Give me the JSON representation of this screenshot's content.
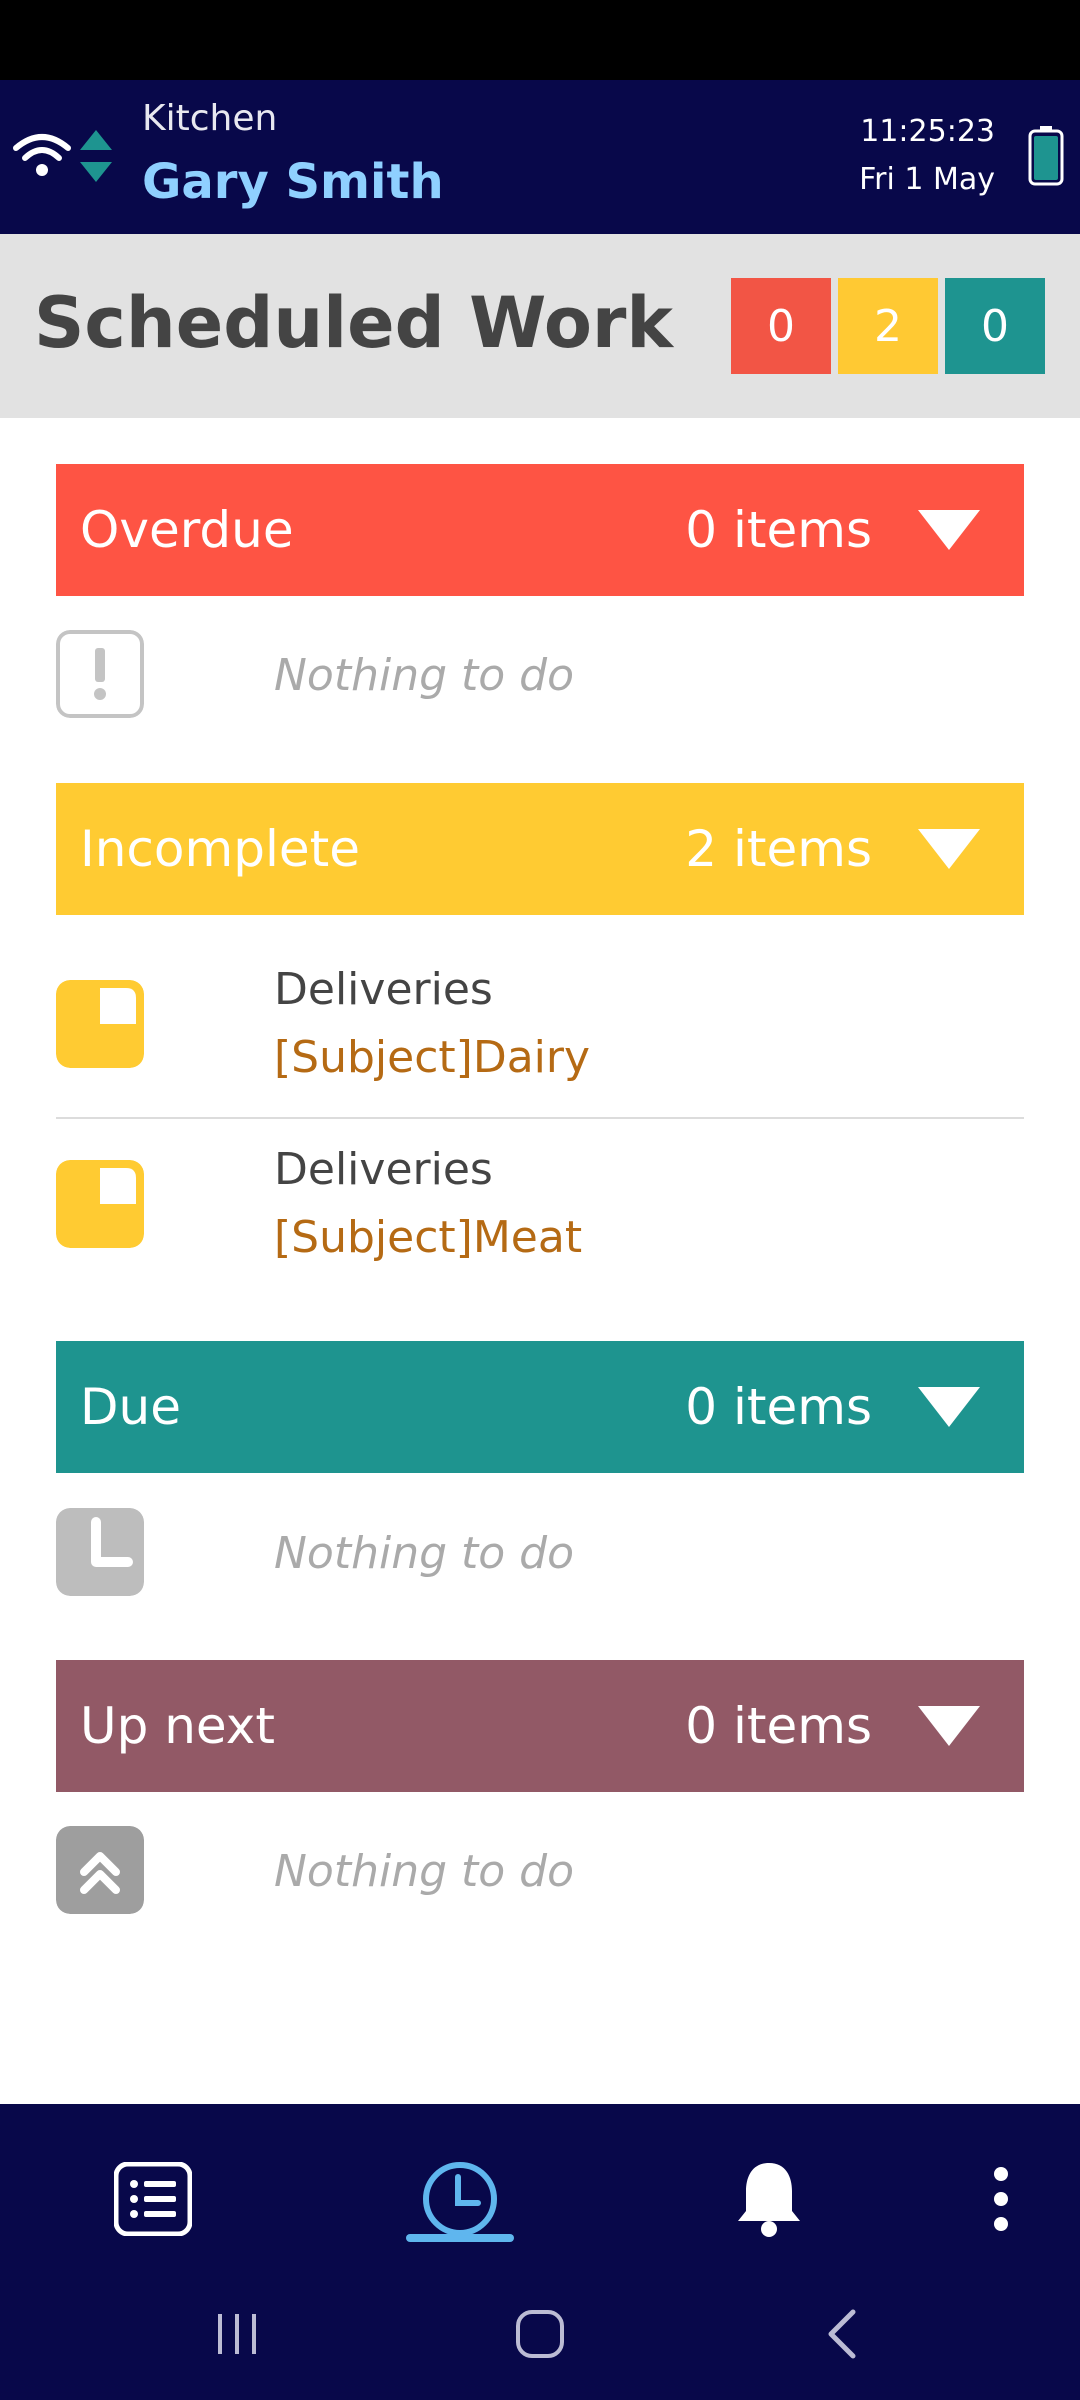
{
  "header": {
    "location": "Kitchen",
    "user_name": "Gary Smith",
    "time": "11:25:23",
    "date": "Fri 1 May"
  },
  "page": {
    "title": "Scheduled Work",
    "badges": [
      {
        "value": "0",
        "color": "#f25545"
      },
      {
        "value": "2",
        "color": "#ffc933"
      },
      {
        "value": "0",
        "color": "#1e9490"
      }
    ]
  },
  "sections": [
    {
      "label": "Overdue",
      "count": "0 items",
      "color": "#fe5444",
      "empty_text": "Nothing to do",
      "icon": "exclamation-icon"
    },
    {
      "label": "Incomplete",
      "count": "2 items",
      "color": "#ffcb32",
      "items": [
        {
          "title": "Deliveries",
          "subject": "[Subject]Dairy"
        },
        {
          "title": "Deliveries",
          "subject": "[Subject]Meat"
        }
      ],
      "icon": "partial-progress-icon"
    },
    {
      "label": "Due",
      "count": "0 items",
      "color": "#1e948f",
      "empty_text": "Nothing to do",
      "icon": "clock-icon"
    },
    {
      "label": "Up next",
      "count": "0 items",
      "color": "#925966",
      "empty_text": "Nothing to do",
      "icon": "double-chevron-up-icon"
    }
  ],
  "colors": {
    "header_bg": "#08084a",
    "accent_blue": "#5fb6ee",
    "subject_text": "#b56a14"
  },
  "bottom_nav": {
    "items": [
      "list-icon",
      "clock-icon",
      "bell-icon",
      "more-vertical-icon"
    ],
    "active": "clock-icon"
  }
}
